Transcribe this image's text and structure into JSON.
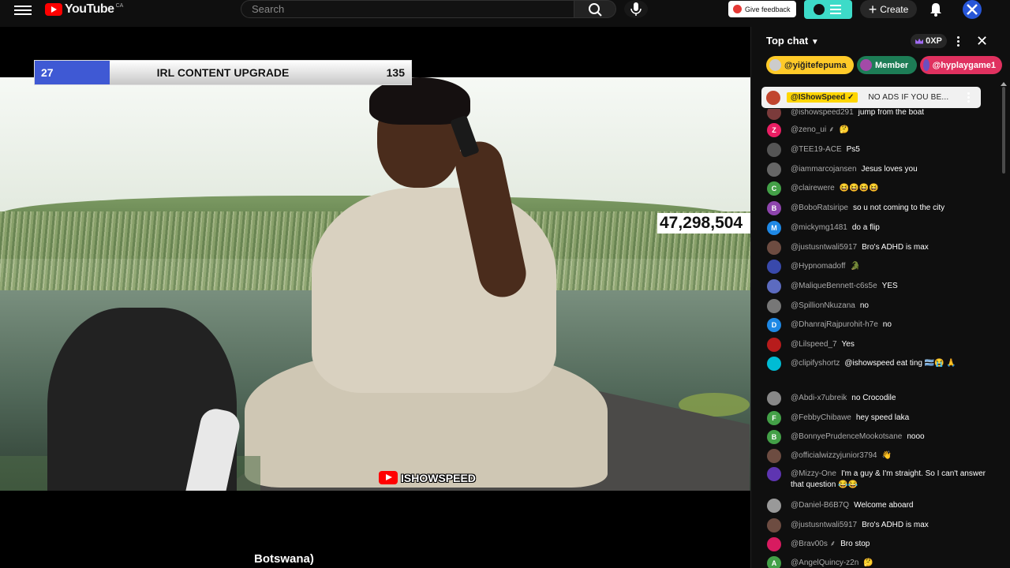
{
  "topbar": {
    "logo_text": "YouTube",
    "region": "CA",
    "search_placeholder": "Search",
    "feedback_label": "Give feedback",
    "create_label": "Create"
  },
  "player": {
    "progress": {
      "current": "27",
      "title": "IRL CONTENT UPGRADE",
      "goal": "135",
      "fill_fraction": 0.2
    },
    "view_count": "47,298,504",
    "watermark": "ISHOWSPEED",
    "title_fragment": "Botswana)"
  },
  "chat": {
    "title": "Top chat",
    "xp": "0XP",
    "chips": [
      {
        "label": "@yiğitefepuma",
        "color": "#ffca28"
      },
      {
        "label": "Member",
        "color": "#1d7d56"
      },
      {
        "label": "@hyplaygame1",
        "color": "#e0315f"
      }
    ],
    "pinned": {
      "author": "@IShowSpeed ✓",
      "message": "NO ADS IF YOU BE..."
    },
    "messages": [
      {
        "author": "@ishowspeed291",
        "text": "jump from the boat",
        "avatar": "",
        "color": "#7b3b3b"
      },
      {
        "author": "@zeno_ui ⸙",
        "text": "🤔",
        "avatar": "Z",
        "color": "#e91e63"
      },
      {
        "author": "@TEE19-ACE",
        "text": "Ps5",
        "avatar": "",
        "color": "#555"
      },
      {
        "author": "@iammarcojansen",
        "text": "Jesus loves you",
        "avatar": "",
        "color": "#666"
      },
      {
        "author": "@clairewere",
        "text": "😆😆😆😆",
        "avatar": "C",
        "color": "#43a047"
      },
      {
        "author": "@BoboRatsiripe",
        "text": "so u not coming to the city",
        "avatar": "B",
        "color": "#8e44ad"
      },
      {
        "author": "@mickymg1481",
        "text": "do a flip",
        "avatar": "M",
        "color": "#1e88e5"
      },
      {
        "author": "@justusntwali5917",
        "text": "Bro's ADHD is max",
        "avatar": "",
        "color": "#6d4c41"
      },
      {
        "author": "@Hypnomadoff",
        "text": "🐊",
        "avatar": "",
        "color": "#3949ab"
      },
      {
        "author": "@MaliqueBennett-c6s5e",
        "text": "YES",
        "avatar": "",
        "color": "#5c6bc0"
      },
      {
        "author": "@SpillionNkuzana",
        "text": "no",
        "avatar": "",
        "color": "#777"
      },
      {
        "author": "@DhanrajRajpurohit-h7e",
        "text": "no",
        "avatar": "D",
        "color": "#1e88e5"
      },
      {
        "author": "@Lilspeed_7",
        "text": "Yes",
        "avatar": "",
        "color": "#b71c1c"
      },
      {
        "author": "@clipifyshortz",
        "text": "@ishowspeed eat ting 🇧🇼😭 🙏",
        "avatar": "",
        "color": "#00bcd4"
      },
      {
        "author": "@Abdi-x7ubreik",
        "text": "no Crocodile",
        "avatar": "",
        "color": "#888"
      },
      {
        "author": "@FebbyChibawe",
        "text": "hey speed laka",
        "avatar": "F",
        "color": "#43a047"
      },
      {
        "author": "@BonnyePrudenceMookotsane",
        "text": "nooo",
        "avatar": "B",
        "color": "#43a047"
      },
      {
        "author": "@officialwizzyjunior3794",
        "text": "👋",
        "avatar": "",
        "color": "#6d4c41"
      },
      {
        "author": "@Mizzy-One",
        "text": "I'm a guy & I'm straight. So I can't answer that question 😂😂",
        "avatar": "",
        "color": "#5e35b1"
      },
      {
        "author": "@Daniel-B6B7Q",
        "text": "Welcome aboard",
        "avatar": "",
        "color": "#999"
      },
      {
        "author": "@justusntwali5917",
        "text": "Bro's ADHD is max",
        "avatar": "",
        "color": "#6d4c41"
      },
      {
        "author": "@Brav00s ⸙",
        "text": "Bro stop",
        "avatar": "",
        "color": "#d81b60"
      },
      {
        "author": "@AngelQuincy-z2n",
        "text": "🤔",
        "avatar": "A",
        "color": "#43a047"
      }
    ]
  }
}
